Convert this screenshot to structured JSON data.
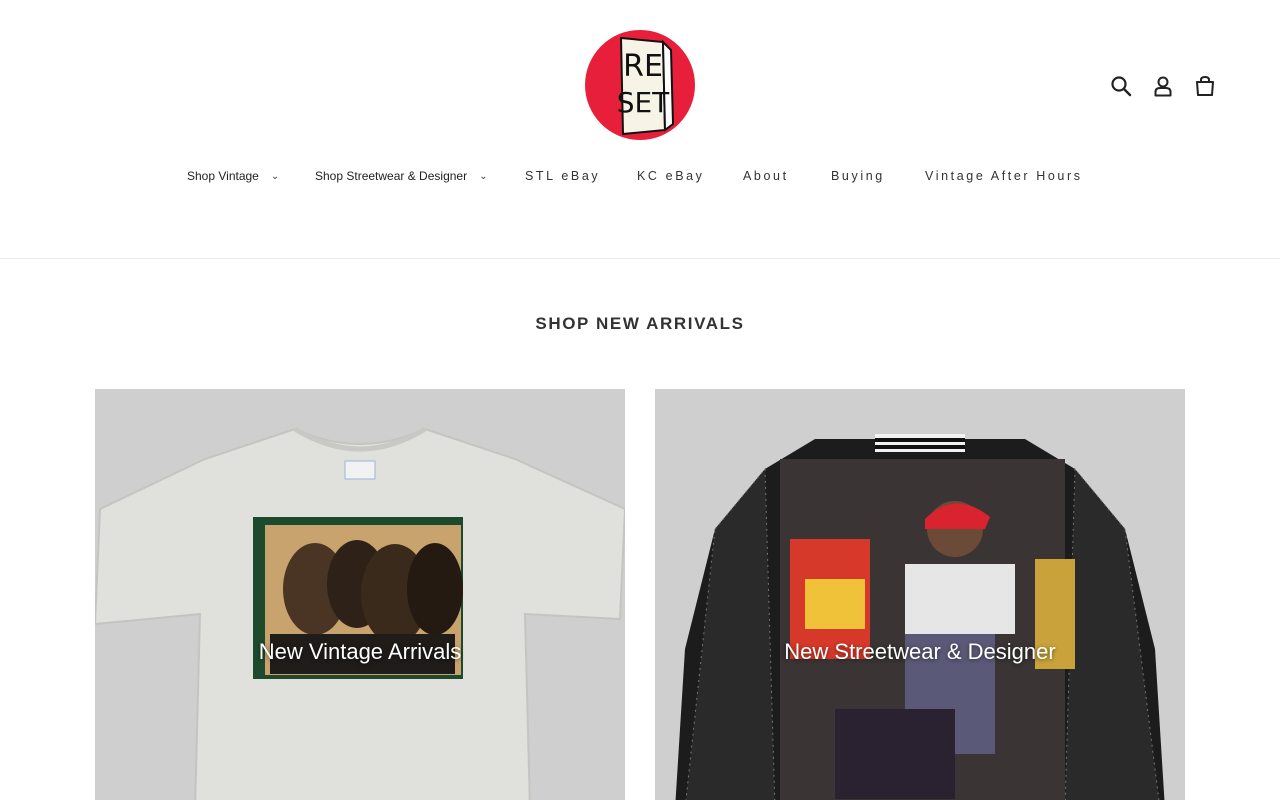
{
  "logo": {
    "text_top": "RE",
    "text_bottom": "SET",
    "colors": {
      "circle": "#e81f3a",
      "block": "#f7f3e6",
      "ink": "#111111"
    }
  },
  "header": {
    "icons": [
      "search-icon",
      "account-icon",
      "cart-icon"
    ]
  },
  "nav": {
    "items": [
      {
        "label": "Shop Vintage",
        "dropdown": true
      },
      {
        "label": "Shop Streetwear & Designer",
        "dropdown": true
      },
      {
        "label": "STL eBay"
      },
      {
        "label": "KC eBay"
      },
      {
        "label": "About"
      },
      {
        "label": "Buying"
      },
      {
        "label": "Vintage After Hours"
      }
    ],
    "chevron": "⌄"
  },
  "section": {
    "title": "SHOP NEW ARRIVALS"
  },
  "collections": [
    {
      "label": "New Vintage Arrivals"
    },
    {
      "label": "New Streetwear & Designer"
    }
  ]
}
